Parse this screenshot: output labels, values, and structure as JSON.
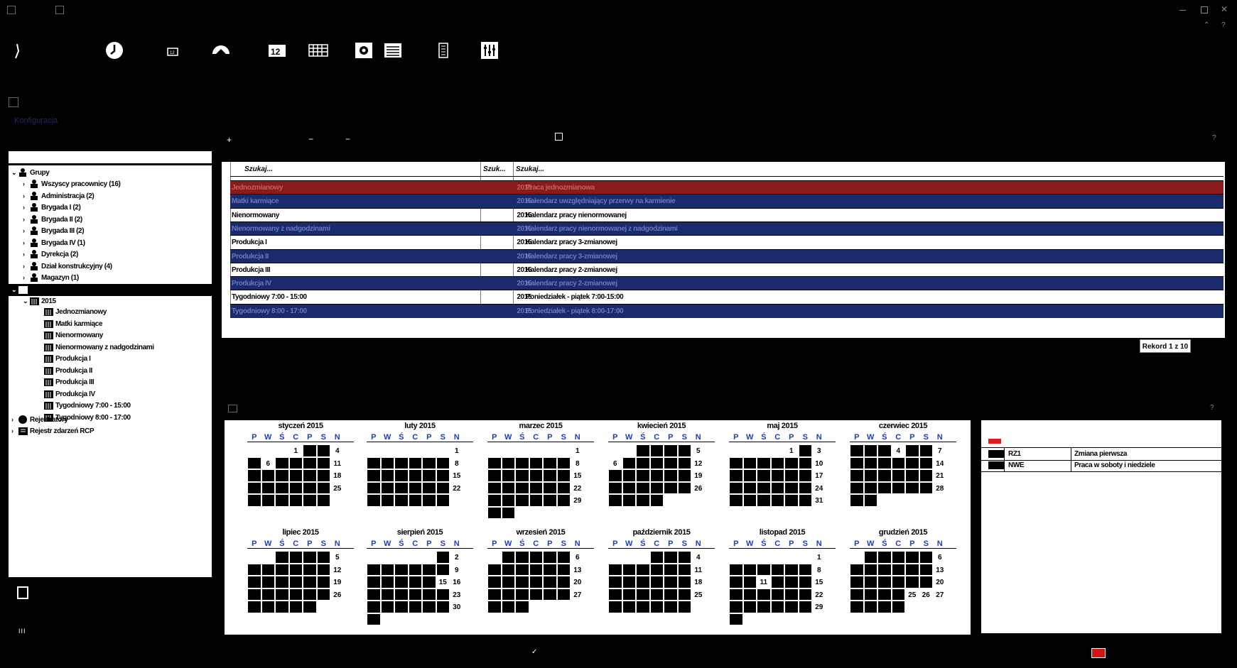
{
  "toolbar": {
    "help_q": "?"
  },
  "side": {
    "config_label": "Konfiguracja"
  },
  "tree": {
    "groups_label": "Grupy",
    "group_items": [
      "Wszyscy pracownicy (16)",
      "Administracja (2)",
      "Brygada I (2)",
      "Brygada II (2)",
      "Brygada III (2)",
      "Brygada IV (1)",
      "Dyrekcja (2)",
      "Dział konstrukcyjny (4)",
      "Magazyn (1)"
    ],
    "year_label": "2015",
    "calendar_items": [
      "Jednozmianowy",
      "Matki karmiące",
      "Nienormowany",
      "Nienormowany z nadgodzinami",
      "Produkcja I",
      "Produkcja II",
      "Produkcja III",
      "Produkcja IV",
      "Tygodniowy 7:00 - 15:00",
      "Tygodniowy 8:00 - 17:00"
    ],
    "registrars_label": "Rejestratory",
    "rcp_label": "Rejestr zdarzeń RCP"
  },
  "grid": {
    "search_placeholder_1": "Szukaj...",
    "search_placeholder_2": "Szuk...",
    "search_placeholder_3": "Szukaj...",
    "rows": [
      {
        "name": "Jednozmianowy",
        "year": "2015",
        "desc": "Praca jednozmianowa",
        "style": "red"
      },
      {
        "name": "Matki karmiące",
        "year": "2015",
        "desc": "Kalendarz uwzględniający przerwy na karmienie",
        "style": "blue"
      },
      {
        "name": "Nienormowany",
        "year": "2015",
        "desc": "Kalendarz pracy nienormowanej",
        "style": "white"
      },
      {
        "name": "Nienormowany z nadgodzinami",
        "year": "2015",
        "desc": "Kalendarz pracy nienormowanej z nadgodzinami",
        "style": "blue"
      },
      {
        "name": "Produkcja I",
        "year": "2015",
        "desc": "Kalendarz pracy 3-zmianowej",
        "style": "white"
      },
      {
        "name": "Produkcja II",
        "year": "2015",
        "desc": "Kalendarz pracy 3-zmianowej",
        "style": "blue"
      },
      {
        "name": "Produkcja III",
        "year": "2015",
        "desc": "Kalendarz pracy 2-zmianowej",
        "style": "white"
      },
      {
        "name": "Produkcja IV",
        "year": "2015",
        "desc": "Kalendarz pracy 2-zmianowej",
        "style": "blue"
      },
      {
        "name": "Tygodniowy 7:00 - 15:00",
        "year": "2015",
        "desc": "Poniedziałek - piątek 7:00-15:00",
        "style": "white"
      },
      {
        "name": "Tygodniowy 8:00 - 17:00",
        "year": "2015",
        "desc": "Poniedziałek - piątek 8:00-17:00",
        "style": "blue"
      }
    ],
    "record_label": "Rekord 1 z 10"
  },
  "calendar": {
    "dow": [
      "P",
      "W",
      "Ś",
      "C",
      "P",
      "S",
      "N"
    ],
    "months": [
      {
        "title": "styczeń 2015",
        "offset": 3,
        "len": 31
      },
      {
        "title": "luty 2015",
        "offset": 6,
        "len": 28
      },
      {
        "title": "marzec 2015",
        "offset": 6,
        "len": 31
      },
      {
        "title": "kwiecień 2015",
        "offset": 2,
        "len": 30
      },
      {
        "title": "maj 2015",
        "offset": 4,
        "len": 31
      },
      {
        "title": "czerwiec 2015",
        "offset": 0,
        "len": 30
      },
      {
        "title": "lipiec 2015",
        "offset": 2,
        "len": 31
      },
      {
        "title": "sierpień 2015",
        "offset": 5,
        "len": 31
      },
      {
        "title": "wrzesień 2015",
        "offset": 1,
        "len": 30
      },
      {
        "title": "październik 2015",
        "offset": 3,
        "len": 31
      },
      {
        "title": "listopad 2015",
        "offset": 6,
        "len": 30
      },
      {
        "title": "grudzień 2015",
        "offset": 1,
        "len": 31
      }
    ],
    "visible_days": [
      [
        1,
        4,
        6,
        11,
        18,
        25
      ],
      [
        1,
        8,
        15,
        22
      ],
      [
        1,
        8,
        15,
        22,
        29
      ],
      [
        5,
        6,
        12,
        19,
        26
      ],
      [
        1,
        3,
        10,
        17,
        24,
        31
      ],
      [
        4,
        7,
        14,
        21,
        28
      ],
      [
        5,
        12,
        19,
        26
      ],
      [
        2,
        9,
        15,
        16,
        23,
        30
      ],
      [
        6,
        13,
        20,
        27
      ],
      [
        4,
        11,
        18,
        25
      ],
      [
        1,
        8,
        11,
        15,
        22,
        29
      ],
      [
        6,
        13,
        20,
        25,
        26,
        27
      ]
    ]
  },
  "legend": {
    "rows": [
      {
        "code": "RZ1",
        "name": "Zmiana pierwsza"
      },
      {
        "code": "NWE",
        "name": "Praca w soboty i niedziele"
      }
    ]
  },
  "colors": {
    "blue_row": "#1b2a6b",
    "red_row": "#8b1a1a",
    "dow_blue": "#1a3fb8"
  }
}
